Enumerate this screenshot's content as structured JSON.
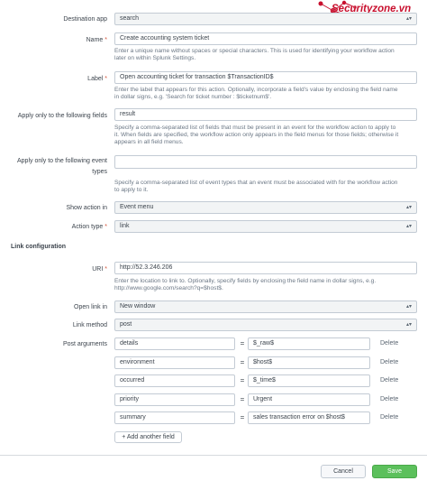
{
  "brand": {
    "name": "Securityzone.vn"
  },
  "form": {
    "destination_app": {
      "label": "Destination app",
      "value": "search"
    },
    "name": {
      "label": "Name",
      "required": "*",
      "value": "Create accounting system ticket",
      "help": [
        "Enter a unique name without spaces or special characters. This is used for identifying your workflow action",
        "later on within Splunk Settings."
      ]
    },
    "action_label": {
      "label": "Label",
      "required": "*",
      "value": "Open accounting ticket for transaction $TransactionID$",
      "help": [
        "Enter the label that appears for this action. Optionally, incorporate a field's value by enclosing the field name",
        "in dollar signs, e.g. 'Search for ticket number : $ticketnum$'."
      ]
    },
    "fields": {
      "label": "Apply only to the following fields",
      "value": "result",
      "help": [
        "Specify a comma-separated list of fields that must be present in an event for the workflow action to apply to",
        "it. When fields are specified, the workflow action only appears in the field menus for those fields; otherwise it",
        "appears in all field menus."
      ]
    },
    "event_types": {
      "label": [
        "Apply only to the following event",
        "types"
      ],
      "value": "",
      "help": [
        "Specify a comma-separated list of event types that an event must be associated with for the workflow action",
        "to apply to it."
      ]
    },
    "show_action_in": {
      "label": "Show action in",
      "value": "Event menu"
    },
    "action_type": {
      "label": "Action type",
      "required": "*",
      "value": "link"
    }
  },
  "link_config": {
    "heading": "Link configuration",
    "uri": {
      "label": "URI",
      "required": "*",
      "value": "http://52.3.246.206",
      "help": [
        "Enter the location to link to. Optionally, specify fields by enclosing the field name in dollar signs, e.g.",
        "http://www.google.com/search?q=$host$."
      ]
    },
    "open_link_in": {
      "label": "Open link in",
      "value": "New window"
    },
    "link_method": {
      "label": "Link method",
      "value": "post"
    },
    "post_arguments": {
      "label": "Post arguments",
      "equals": "=",
      "delete_label": "Delete",
      "rows": [
        {
          "key": "details",
          "value": "$_raw$"
        },
        {
          "key": "environment",
          "value": "$host$"
        },
        {
          "key": "occurred",
          "value": "$_time$"
        },
        {
          "key": "priority",
          "value": "Urgent"
        },
        {
          "key": "summary",
          "value": "sales transaction error on $host$"
        }
      ],
      "add_label": "+ Add another field"
    }
  },
  "footer": {
    "cancel_label": "Cancel",
    "save_label": "Save"
  },
  "colors": {
    "save_green": "#5cc05c",
    "logo_red": "#c8102e"
  }
}
